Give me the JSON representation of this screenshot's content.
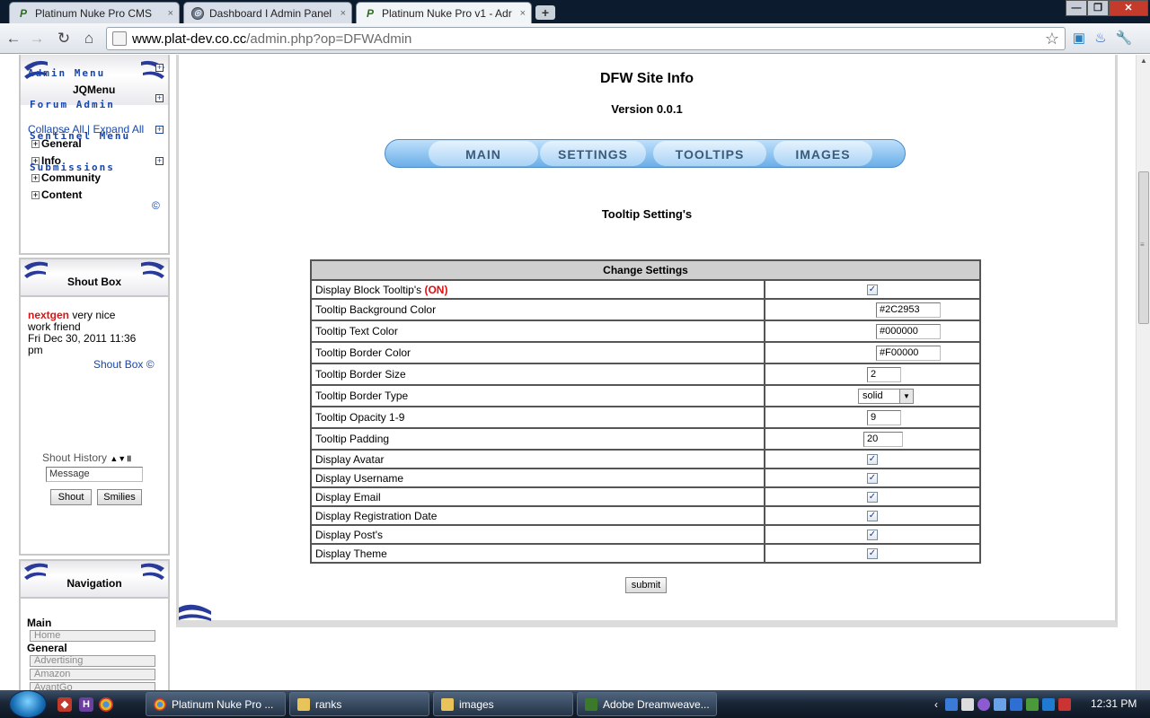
{
  "browser": {
    "tabs": [
      {
        "title": "Platinum Nuke Pro CMS",
        "close": "×",
        "icon": "platinum-nuke-icon"
      },
      {
        "title": "Dashboard I Admin Panel",
        "close": "×",
        "icon": "globe-icon"
      },
      {
        "title": "Platinum Nuke Pro v1 - Adr",
        "close": "×",
        "icon": "platinum-nuke-icon"
      }
    ],
    "new_tab": "+",
    "url_host": "www.plat-dev.co.cc",
    "url_path": "/admin.php?op=DFWAdmin",
    "window_controls": {
      "minimize": "—",
      "maximize": "❐",
      "close": "✕"
    }
  },
  "sidebar": {
    "admin_menu": {
      "admin_menu_label": "Admin Menu",
      "jqmenu_label": "JQMenu",
      "forum_admin_label": "Forum Admin",
      "collapse_all": "Collapse All",
      "separator": " | ",
      "expand_all": "Expand All",
      "sentinel_menu_label": "Sentinel Menu",
      "submissions_label": "Submissions",
      "tree": [
        "General",
        "Info",
        "Community",
        "Content"
      ],
      "copyright": "©"
    },
    "shoutbox": {
      "title": "Shout Box",
      "author": "nextgen",
      "message_tail": " very nice",
      "message_line2": "work friend",
      "date": "Fri Dec 30, 2011 11:36",
      "date_tail": "pm",
      "footer_link": "Shout Box ©",
      "history_label": "Shout History",
      "message_placeholder": "Message",
      "shout_button": "Shout",
      "smilies_button": "Smilies"
    },
    "navigation": {
      "title": "Navigation",
      "sections": [
        {
          "heading": "Main",
          "items": [
            "Home"
          ]
        },
        {
          "heading": "General",
          "items": [
            "Advertising",
            "Amazon",
            "AvantGo"
          ]
        }
      ]
    }
  },
  "main": {
    "title": "DFW Site Info",
    "version": "Version 0.0.1",
    "tabs": [
      "MAIN",
      "SETTINGS",
      "TOOLTIPS",
      "IMAGES"
    ],
    "section_title": "Tooltip Setting's",
    "table_header": "Change Settings",
    "block_tooltips_label": "Display Block Tooltip's",
    "block_tooltips_state": "(ON)",
    "text_settings": [
      {
        "label": "Tooltip Background Color",
        "value": "#2C2953"
      },
      {
        "label": "Tooltip Text Color",
        "value": "#000000"
      },
      {
        "label": "Tooltip Border Color",
        "value": "#F00000"
      },
      {
        "label": "Tooltip Border Size",
        "value": "2"
      }
    ],
    "border_type": {
      "label": "Tooltip Border Type",
      "value": "solid"
    },
    "opacity": {
      "label": "Tooltip Opacity 1-9",
      "value": "9"
    },
    "padding": {
      "label": "Tooltip Padding",
      "value": "20"
    },
    "checkbox_settings": [
      {
        "label": "Display Avatar",
        "checked": true
      },
      {
        "label": "Display Username",
        "checked": true
      },
      {
        "label": "Display Email",
        "checked": true
      },
      {
        "label": "Display Registration Date",
        "checked": true
      },
      {
        "label": "Display Post's",
        "checked": true
      },
      {
        "label": "Display Theme",
        "checked": true
      }
    ],
    "checkmark": "✓",
    "submit_label": "submit"
  },
  "taskbar": {
    "buttons": [
      "Platinum Nuke Pro ...",
      "ranks",
      "images",
      "Adobe Dreamweave..."
    ],
    "clock": "12:31 PM"
  },
  "colors": {
    "accent_blue": "#1846a8",
    "on_red": "#dd1111",
    "tab_blue": "#6aaee8"
  }
}
